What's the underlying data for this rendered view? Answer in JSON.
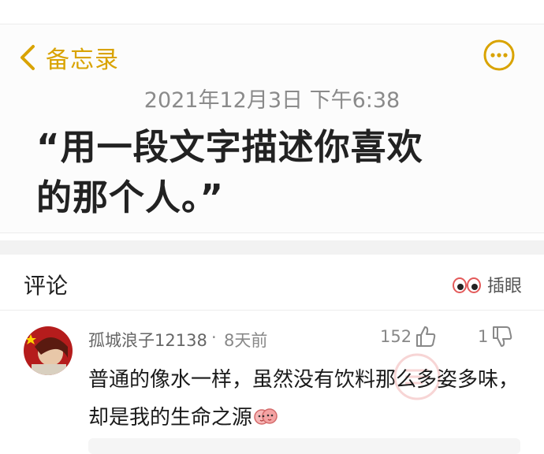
{
  "nav": {
    "back_label": "备忘录"
  },
  "note": {
    "date": "2021年12月3日 下午6:38",
    "title_line1": "“用一段文字描述你喜欢",
    "title_line2": "的那个人。”"
  },
  "comments_header": {
    "title": "评论",
    "insert_label": "插眼"
  },
  "comment": {
    "username": "孤城浪子12138",
    "separator": "·",
    "time": "8天前",
    "likes": "152",
    "dislikes": "1",
    "text": "普通的像水一样，虽然没有饮料那么多姿多味，却是我的生命之源"
  },
  "colors": {
    "accent": "#d9a300",
    "divider": "#f2f2f2"
  },
  "icons": [
    "back-chevron-icon",
    "more-icon",
    "eyes-icon",
    "thumbs-up-icon",
    "thumbs-down-icon",
    "avatar",
    "emoji"
  ]
}
